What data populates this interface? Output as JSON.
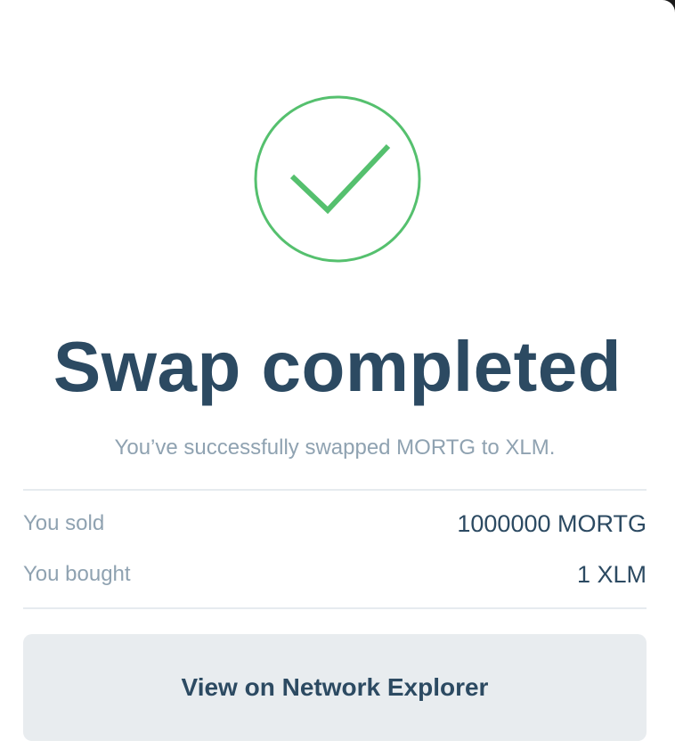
{
  "status_icon": {
    "name": "checkmark-circle-icon",
    "color": "#55c06e"
  },
  "title": "Swap completed",
  "subtitle": "You’ve successfully swapped MORTG to XLM.",
  "summary": {
    "sold_label": "You sold",
    "sold_value": "1000000 MORTG",
    "bought_label": "You bought",
    "bought_value": "1 XLM"
  },
  "actions": {
    "explorer_label": "View on Network Explorer"
  },
  "colors": {
    "title": "#2c4a62",
    "muted": "#8fa2b1",
    "success": "#55c06e",
    "button_bg": "#e8ecef"
  }
}
